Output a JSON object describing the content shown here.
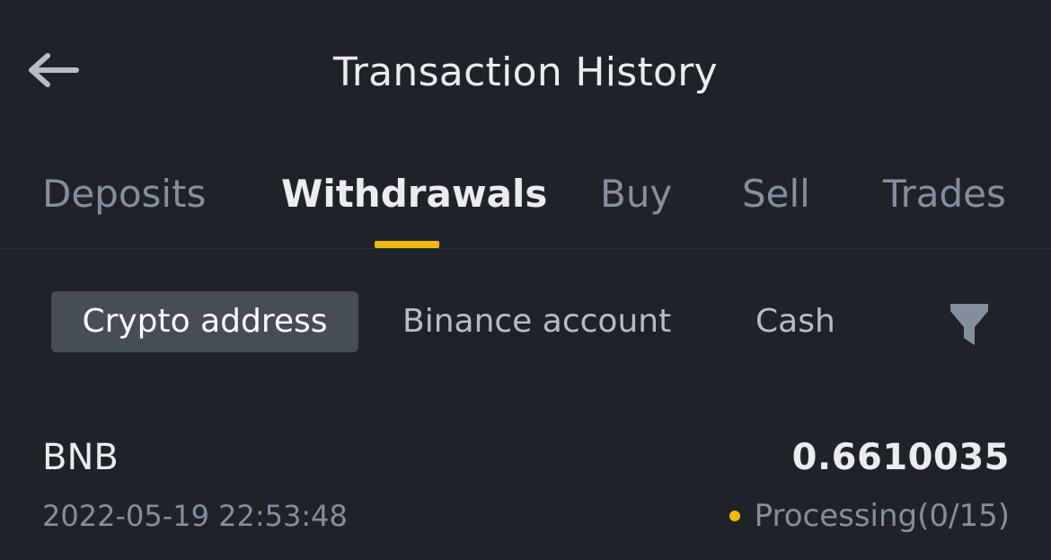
{
  "header": {
    "title": "Transaction History",
    "back_icon": "arrow-left-icon"
  },
  "tabs": [
    {
      "label": "Deposits",
      "active": false
    },
    {
      "label": "Withdrawals",
      "active": true
    },
    {
      "label": "Buy",
      "active": false
    },
    {
      "label": "Sell",
      "active": false
    },
    {
      "label": "Trades",
      "active": false
    }
  ],
  "subtabs": [
    {
      "label": "Crypto address",
      "active": true
    },
    {
      "label": "Binance account",
      "active": false
    },
    {
      "label": "Cash",
      "active": false
    }
  ],
  "filter_icon": "filter-icon",
  "transactions": [
    {
      "coin": "BNB",
      "amount": "0.6610035",
      "time": "2022-05-19 22:53:48",
      "status": "Processing(0/15)"
    }
  ],
  "colors": {
    "background": "#1f2229",
    "accent": "#f0b90b",
    "text_primary": "#eaecef",
    "text_secondary": "#848e9c",
    "chip_active_bg": "#474d57"
  }
}
